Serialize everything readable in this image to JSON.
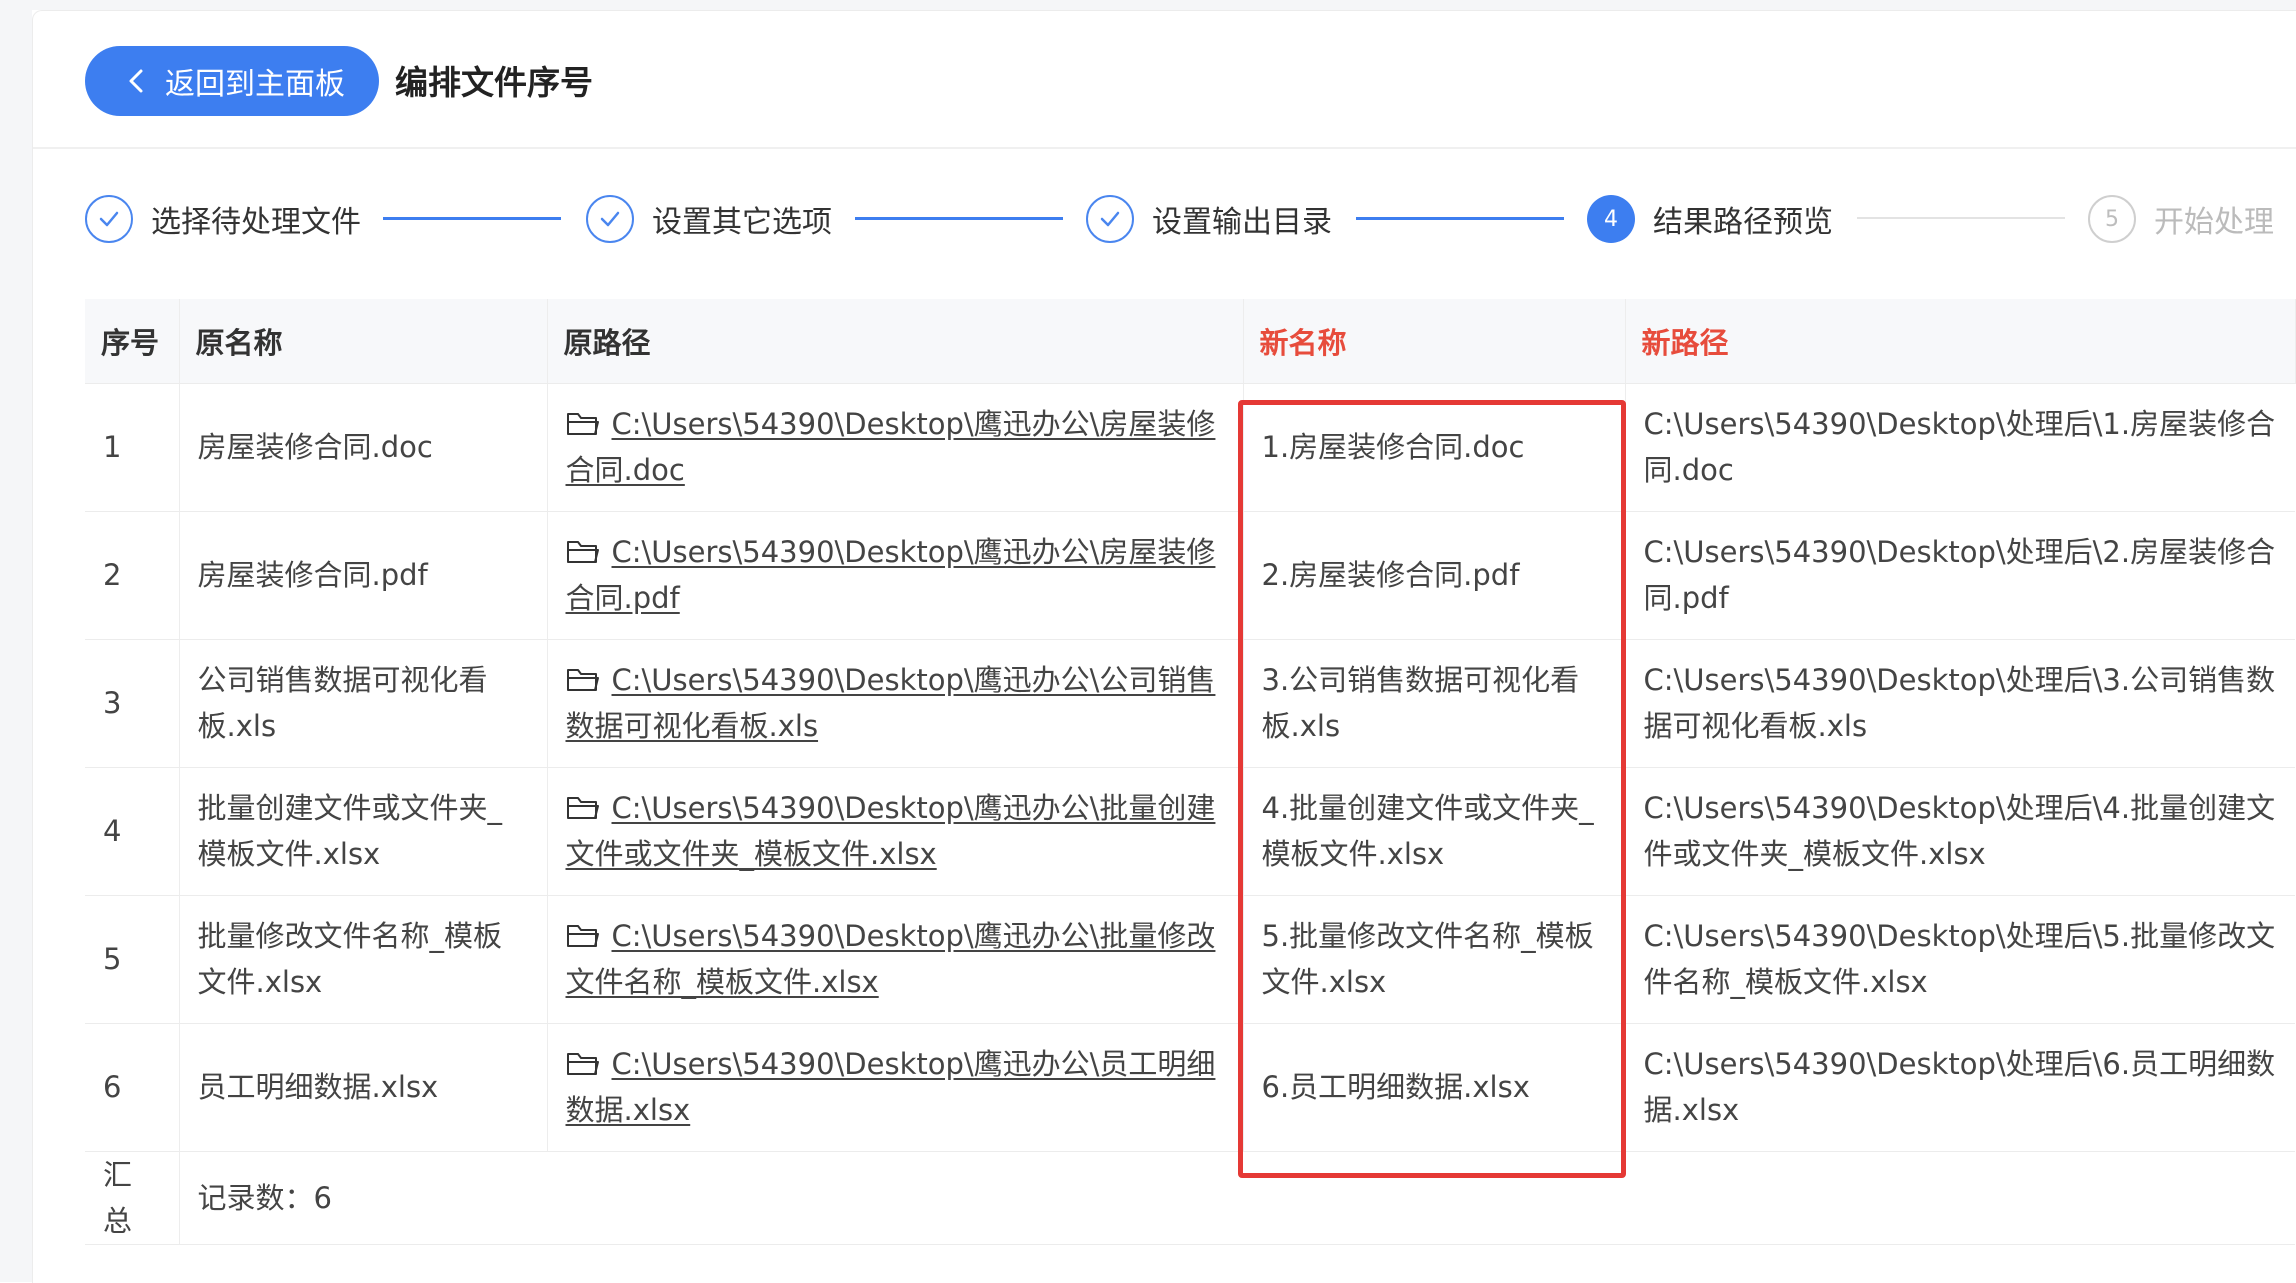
{
  "header": {
    "back_label": "返回到主面板",
    "title": "编排文件序号"
  },
  "steps": [
    {
      "number": "1",
      "label": "选择待处理文件",
      "status": "done"
    },
    {
      "number": "2",
      "label": "设置其它选项",
      "status": "done"
    },
    {
      "number": "3",
      "label": "设置输出目录",
      "status": "done"
    },
    {
      "number": "4",
      "label": "结果路径预览",
      "status": "active"
    },
    {
      "number": "5",
      "label": "开始处理",
      "status": "todo"
    }
  ],
  "table": {
    "columns": [
      "序号",
      "原名称",
      "原路径",
      "新名称",
      "新路径"
    ],
    "rows": [
      {
        "seq": "1",
        "name": "房屋装修合同.doc",
        "path": "C:\\Users\\54390\\Desktop\\鹰迅办公\\房屋装修合同.doc",
        "new_name": "1.房屋装修合同.doc",
        "new_path": "C:\\Users\\54390\\Desktop\\处理后\\1.房屋装修合同.doc"
      },
      {
        "seq": "2",
        "name": "房屋装修合同.pdf",
        "path": "C:\\Users\\54390\\Desktop\\鹰迅办公\\房屋装修合同.pdf",
        "new_name": "2.房屋装修合同.pdf",
        "new_path": "C:\\Users\\54390\\Desktop\\处理后\\2.房屋装修合同.pdf"
      },
      {
        "seq": "3",
        "name": "公司销售数据可视化看板.xls",
        "path": "C:\\Users\\54390\\Desktop\\鹰迅办公\\公司销售数据可视化看板.xls",
        "new_name": "3.公司销售数据可视化看板.xls",
        "new_path": "C:\\Users\\54390\\Desktop\\处理后\\3.公司销售数据可视化看板.xls"
      },
      {
        "seq": "4",
        "name": "批量创建文件或文件夹_模板文件.xlsx",
        "path": "C:\\Users\\54390\\Desktop\\鹰迅办公\\批量创建文件或文件夹_模板文件.xlsx",
        "new_name": "4.批量创建文件或文件夹_模板文件.xlsx",
        "new_path": "C:\\Users\\54390\\Desktop\\处理后\\4.批量创建文件或文件夹_模板文件.xlsx"
      },
      {
        "seq": "5",
        "name": "批量修改文件名称_模板文件.xlsx",
        "path": "C:\\Users\\54390\\Desktop\\鹰迅办公\\批量修改文件名称_模板文件.xlsx",
        "new_name": "5.批量修改文件名称_模板文件.xlsx",
        "new_path": "C:\\Users\\54390\\Desktop\\处理后\\5.批量修改文件名称_模板文件.xlsx"
      },
      {
        "seq": "6",
        "name": "员工明细数据.xlsx",
        "path": "C:\\Users\\54390\\Desktop\\鹰迅办公\\员工明细数据.xlsx",
        "new_name": "6.员工明细数据.xlsx",
        "new_path": "C:\\Users\\54390\\Desktop\\处理后\\6.员工明细数据.xlsx"
      }
    ],
    "summary": {
      "label": "汇总",
      "count_text": "记录数：6"
    }
  },
  "colors": {
    "accent": "#3d7ef0",
    "new_column_header": "#e74c3c",
    "highlight_border": "#e53935"
  }
}
